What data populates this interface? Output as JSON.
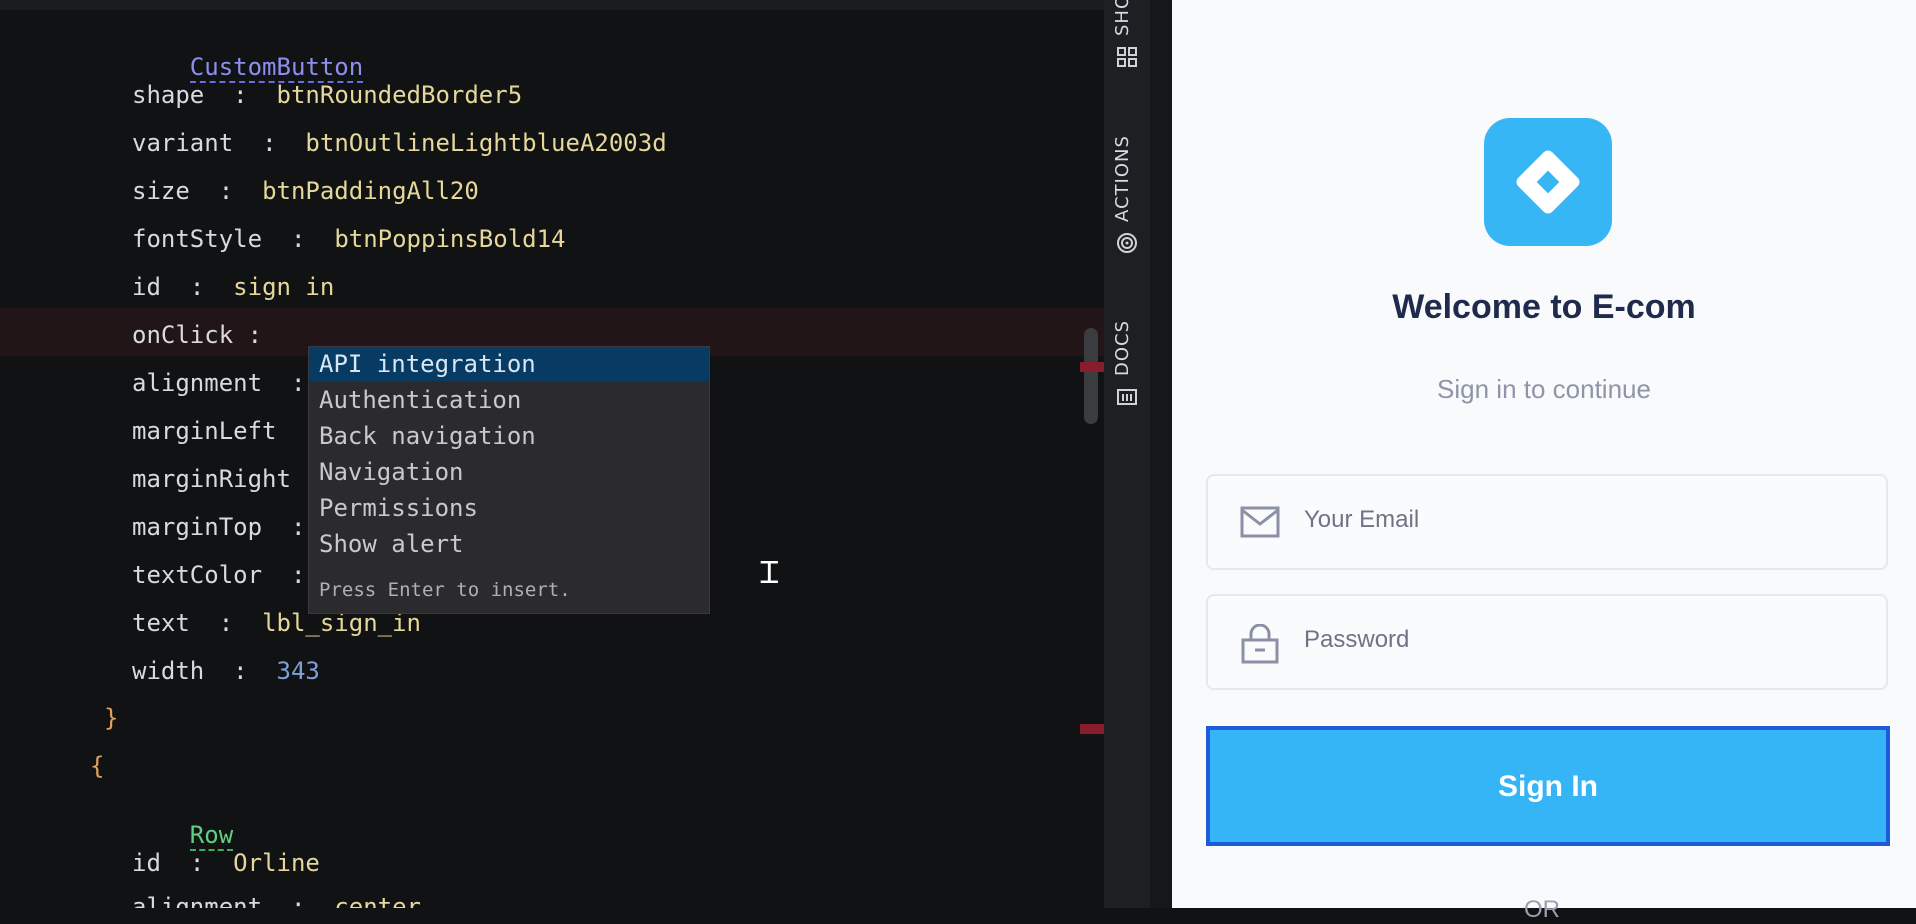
{
  "editor": {
    "component_name": "CustomButton",
    "properties": [
      {
        "key": "shape",
        "value": "btnRoundedBorder5"
      },
      {
        "key": "variant",
        "value": "btnOutlineLightblueA2003d"
      },
      {
        "key": "size",
        "value": "btnPaddingAll20"
      },
      {
        "key": "fontStyle",
        "value": "btnPoppinsBold14"
      },
      {
        "key": "id",
        "value": "sign in"
      },
      {
        "key": "onClick",
        "value": ""
      },
      {
        "key": "alignment",
        "value": ""
      },
      {
        "key": "marginLeft",
        "value": ""
      },
      {
        "key": "marginRight",
        "value": ""
      },
      {
        "key": "marginTop",
        "value": ""
      },
      {
        "key": "textColor",
        "value": ""
      },
      {
        "key": "text",
        "value": "lbl_sign_in"
      },
      {
        "key": "width",
        "value": "343"
      }
    ],
    "close_brace": "}",
    "open_brace": "{",
    "row_component": "Row",
    "row_properties": [
      {
        "key": "id",
        "value": "Orline"
      },
      {
        "key": "alignment",
        "value": "center"
      }
    ],
    "separator": ":"
  },
  "autocomplete": {
    "items": [
      "API integration",
      "Authentication",
      "Back navigation",
      "Navigation",
      "Permissions",
      "Show alert"
    ],
    "selected_index": 0,
    "footer": "Press Enter to insert."
  },
  "side_tabs": {
    "top": "SHO",
    "actions": "ACTIONS",
    "docs": "DOCS"
  },
  "preview": {
    "title": "Welcome to E-com",
    "subtitle": "Sign in to continue",
    "email_placeholder": "Your Email",
    "password_placeholder": "Password",
    "signin_label": "Sign In",
    "or_text": "OR",
    "accent_color": "#35b5f6",
    "title_color": "#1f2a4c"
  }
}
